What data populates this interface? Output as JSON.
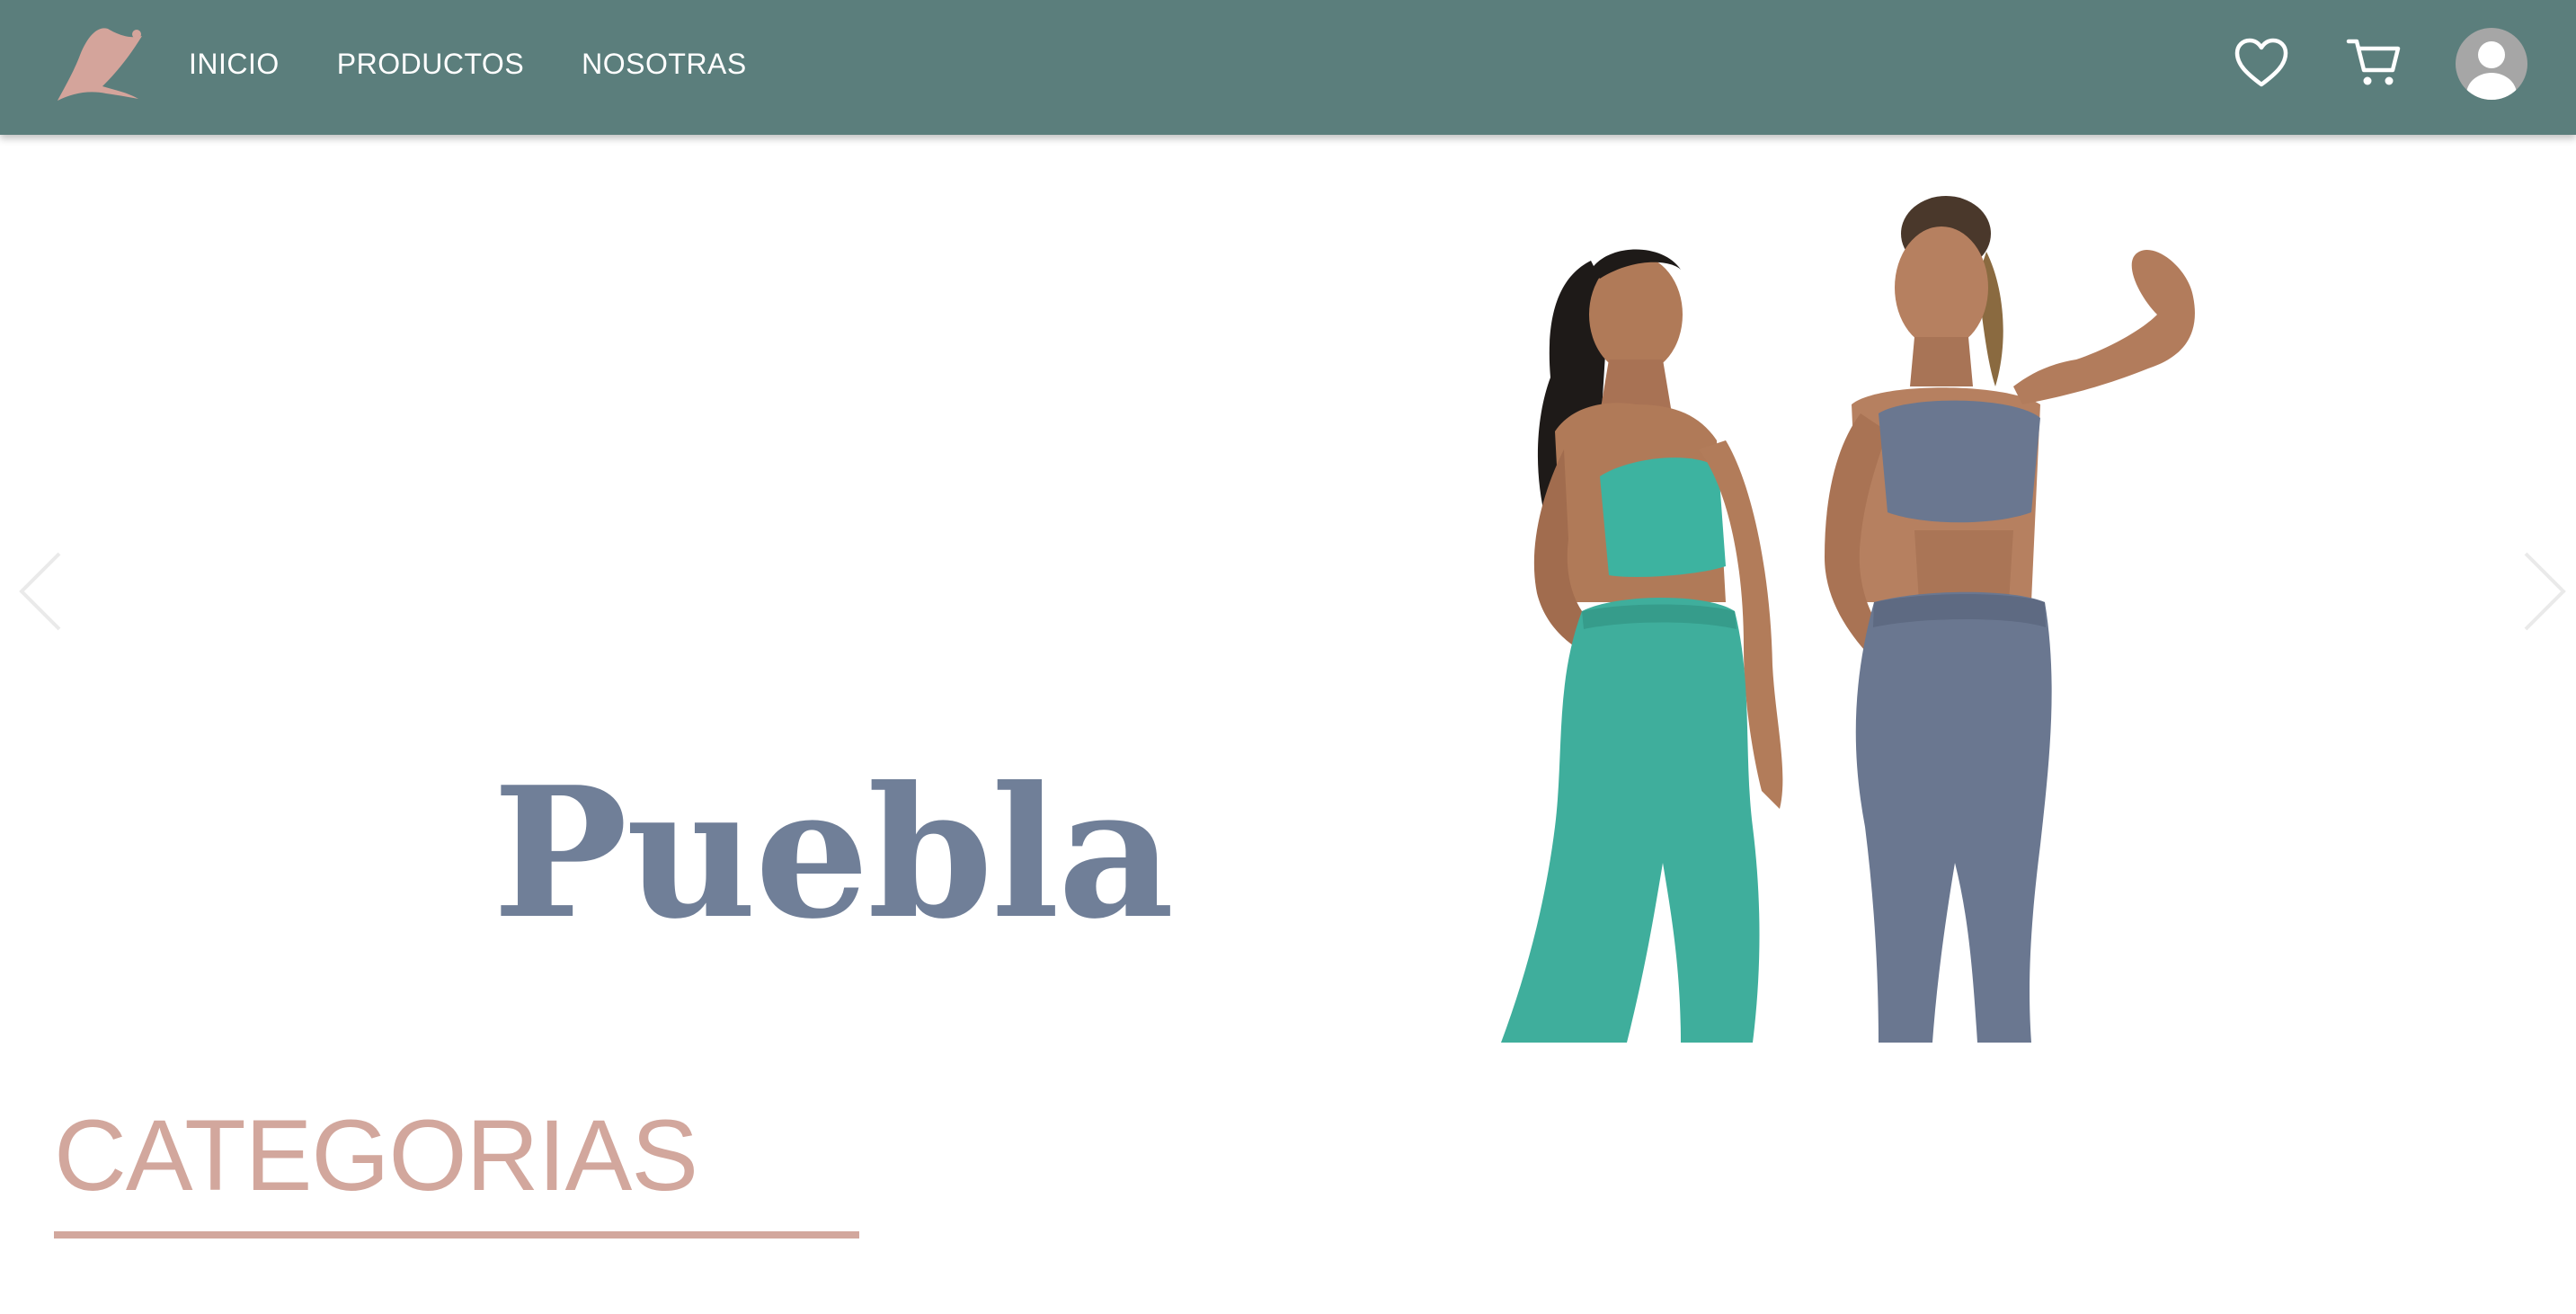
{
  "nav": {
    "links": [
      "INICIO",
      "PRODUCTOS",
      "NOSOTRAS"
    ],
    "icons": [
      "heart-icon",
      "cart-icon",
      "user-avatar-icon"
    ],
    "logo": "brand-logo"
  },
  "hero": {
    "caption": "Puebla",
    "image": "two-women-activewear",
    "controls": [
      "chevron-left-icon",
      "chevron-right-icon"
    ]
  },
  "categories": {
    "title": "CATEGORIAS"
  },
  "colors": {
    "navbar": "#5b7e7c",
    "accent": "#d2a79d",
    "caption": "#707f98",
    "legging_teal": "#3fae9c",
    "legging_gray": "#6a7790"
  }
}
